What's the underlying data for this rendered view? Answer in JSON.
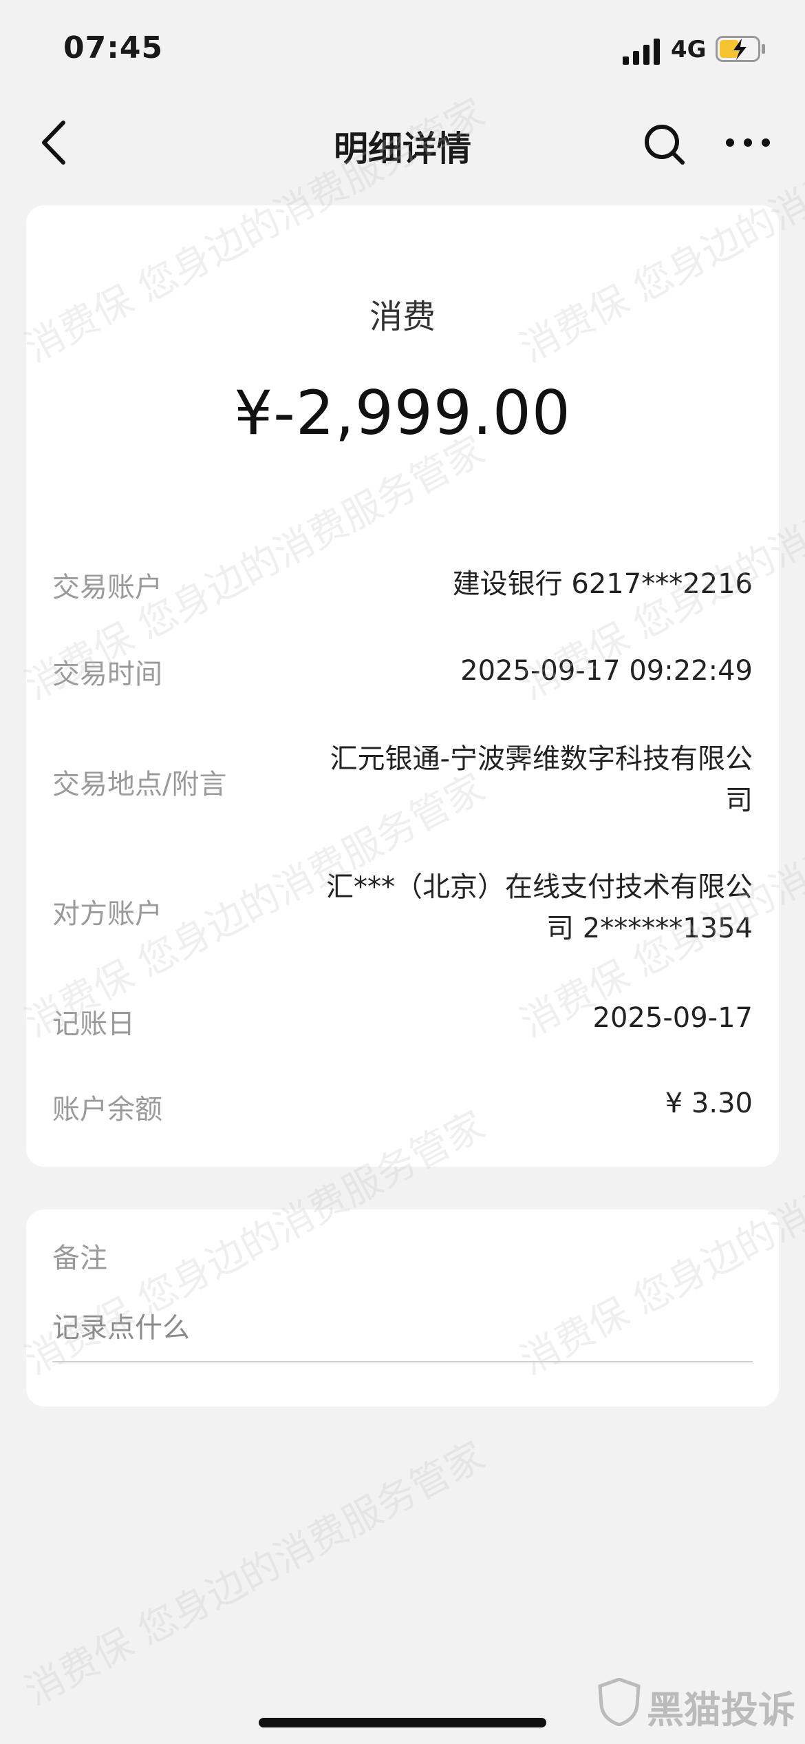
{
  "status_bar": {
    "time": "07:45",
    "network": "4G"
  },
  "nav": {
    "title": "明细详情"
  },
  "summary": {
    "type": "消费",
    "amount": "¥-2,999.00"
  },
  "details": [
    {
      "label": "交易账户",
      "value": "建设银行 6217***2216"
    },
    {
      "label": "交易时间",
      "value": "2025-09-17 09:22:49"
    },
    {
      "label": "交易地点/附言",
      "value_lines": [
        "汇元银通-宁波霁维数字科技有限公",
        "司"
      ]
    },
    {
      "label": "对方账户",
      "value_lines": [
        "汇***（北京）在线支付技术有限公",
        "司 2******1354"
      ]
    },
    {
      "label": "记账日",
      "value": "2025-09-17"
    },
    {
      "label": "账户余额",
      "value": "¥ 3.30"
    }
  ],
  "remark": {
    "label": "备注",
    "placeholder": "记录点什么"
  },
  "watermark": {
    "text": "消费保 您身边的消费服务管家"
  },
  "brand": {
    "text": "黑猫投诉"
  }
}
